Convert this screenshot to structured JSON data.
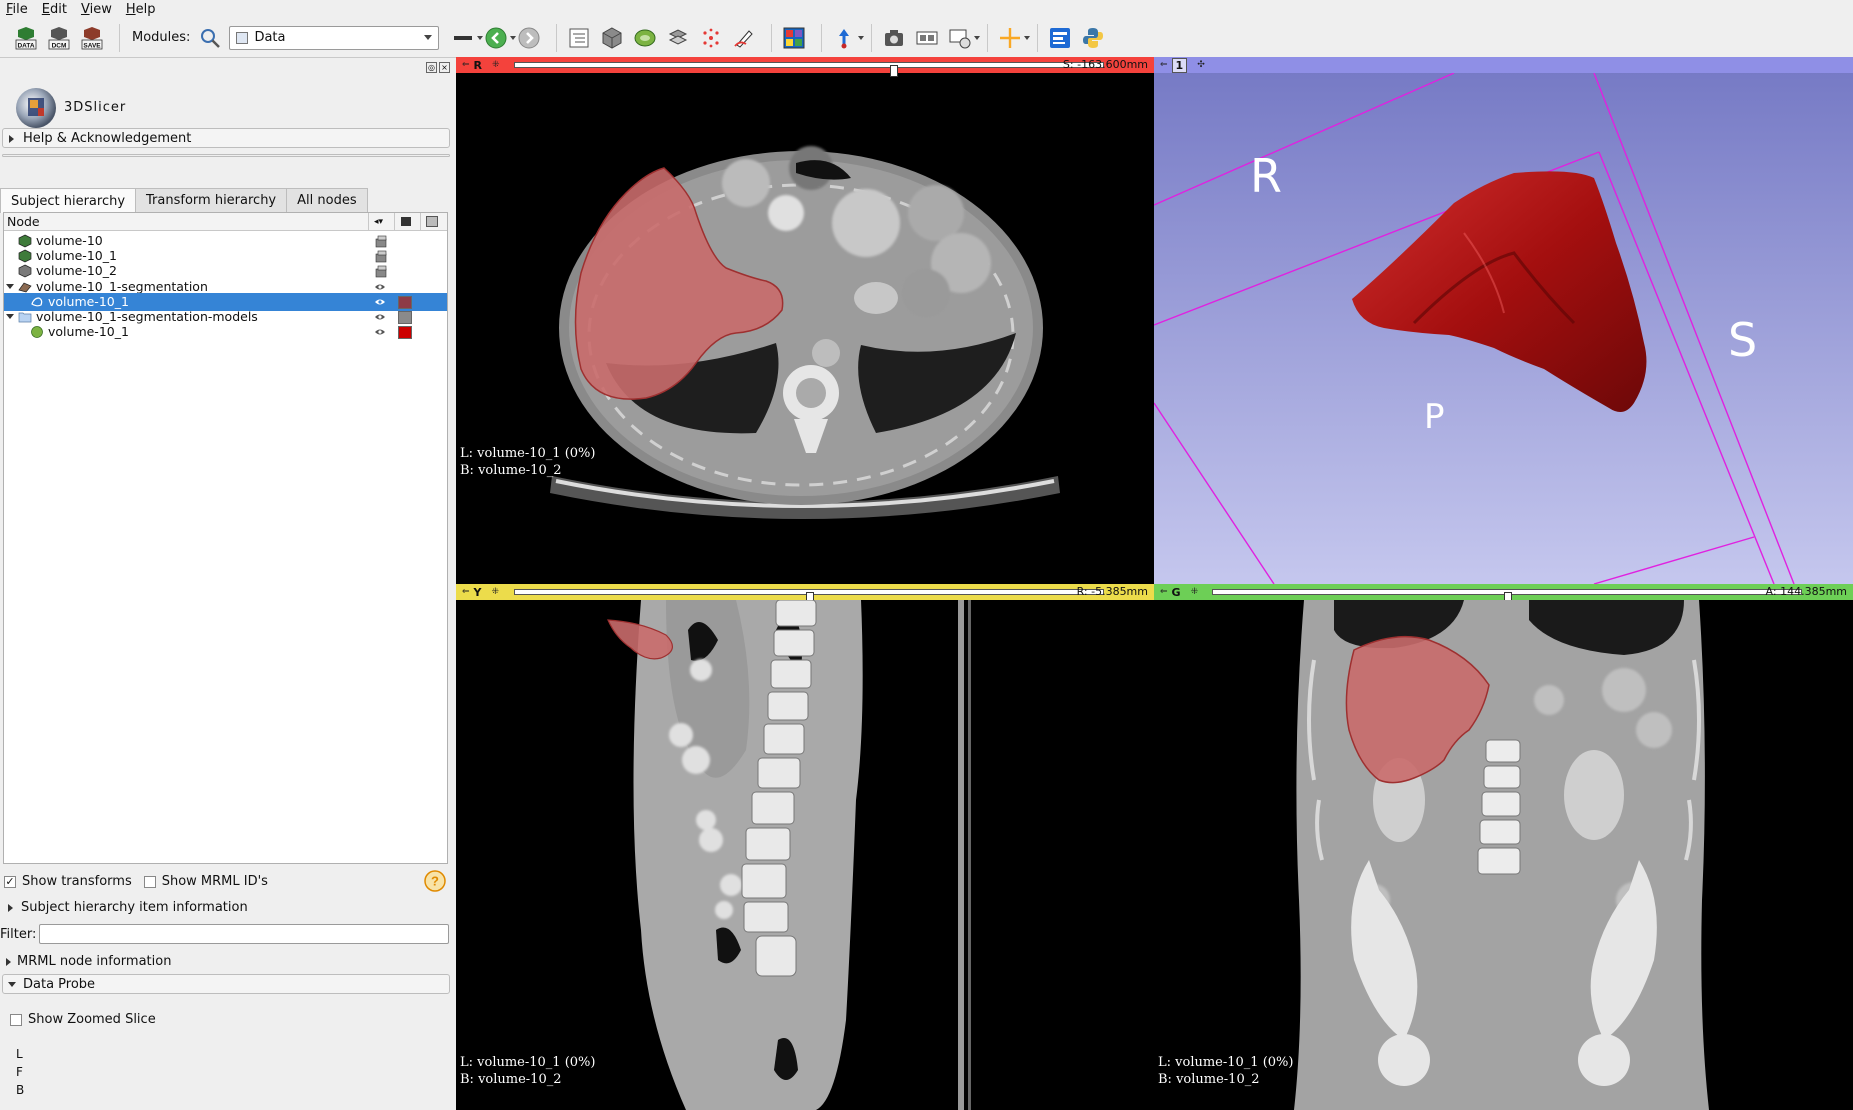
{
  "menubar": {
    "items": [
      "File",
      "Edit",
      "View",
      "Help"
    ]
  },
  "toolbar": {
    "modules_label": "Modules:",
    "module_selected": "Data",
    "buttons": {
      "data": "DATA",
      "dcm": "DCM",
      "save": "SAVE"
    }
  },
  "app": {
    "logo_text": "3DSlicer"
  },
  "sections": {
    "help": "Help & Acknowledgement",
    "subject_item_info": "Subject hierarchy item information",
    "mrml_info": "MRML node information",
    "data_probe": "Data Probe"
  },
  "tabs": [
    "Subject hierarchy",
    "Transform hierarchy",
    "All nodes"
  ],
  "tree": {
    "column_header": "Node",
    "rows": [
      {
        "label": "volume-10",
        "icon": "volume-icon",
        "color": "#3e7b3a"
      },
      {
        "label": "volume-10_1",
        "icon": "volume-icon",
        "color": "#3e7b3a"
      },
      {
        "label": "volume-10_2",
        "icon": "volume-icon",
        "color": "#7a7a7a"
      },
      {
        "label": "volume-10_1-segmentation",
        "icon": "segmentation-icon",
        "swatch": ""
      },
      {
        "label": "volume-10_1",
        "icon": "segment-icon",
        "swatch": "#8e3b46",
        "selected": true
      },
      {
        "label": "volume-10_1-segmentation-models",
        "icon": "folder-icon",
        "swatch": "#8a8a8a"
      },
      {
        "label": "volume-10_1",
        "icon": "model-icon",
        "swatch": "#cc0000"
      }
    ]
  },
  "options": {
    "show_transforms": "Show transforms",
    "show_mrml_ids": "Show MRML ID's",
    "filter_label": "Filter:",
    "show_zoomed_slice": "Show Zoomed Slice"
  },
  "probe": {
    "lines": [
      "L",
      "F",
      "B"
    ]
  },
  "views": {
    "red": {
      "letter": "R",
      "offset": "S: -163.600mm",
      "bar_color": "#f4423c",
      "slider_position": 0.645,
      "layers": [
        "L: volume-10_1 (0%)",
        "B: volume-10_2"
      ]
    },
    "three_d": {
      "letter": "1",
      "bar_color": "#8f8fe6",
      "labels": [
        "R",
        "S",
        "P"
      ],
      "background_top": "#7478c4",
      "background_bottom": "#c5c7ee"
    },
    "yellow": {
      "letter": "Y",
      "offset": "R: -5.385mm",
      "bar_color": "#ecdc4b",
      "slider_position": 0.5,
      "layers": [
        "L: volume-10_1 (0%)",
        "B: volume-10_2"
      ]
    },
    "green": {
      "letter": "G",
      "offset": "A: 144.385mm",
      "bar_color": "#6dcf56",
      "slider_position": 0.5,
      "layers": [
        "L: volume-10_1 (0%)",
        "B: volume-10_2"
      ]
    }
  },
  "colors": {
    "segmentation": "#c96b6b",
    "model": "#b30e0e",
    "selection": "#3584d6"
  }
}
